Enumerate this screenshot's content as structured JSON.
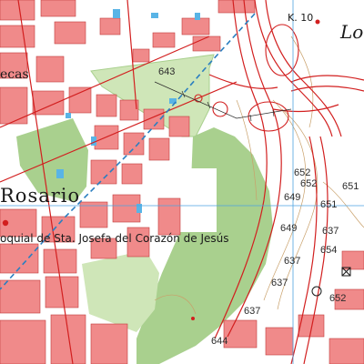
{
  "map": {
    "type": "topographic",
    "colors": {
      "background": "#ffffff",
      "built_block": "#f08a8a",
      "building_outline": "#c23b3b",
      "park_green": "#a9d08e",
      "green_strip": "#cfe6b8",
      "water_blue": "#59b4e6",
      "boundary_line": "#2b7fc0",
      "contour_brown": "#c9a06a",
      "road_red": "#d21f1f",
      "grid_blue": "#4ea3e0"
    },
    "labels": {
      "place_rosario": "Rosario",
      "parish": "oquial de Sta. Josefa del Corazón de Jesús",
      "partial_ecas": "ecas",
      "partial_lo": "Lo",
      "km_marker": "K. 10"
    },
    "elevations": [
      "643",
      "652",
      "652",
      "651",
      "649",
      "651",
      "649",
      "637",
      "654",
      "637",
      "652",
      "637",
      "637",
      "644"
    ],
    "icons": [
      "church-icon",
      "viewpoint-icon",
      "marker-dot-icon"
    ]
  }
}
